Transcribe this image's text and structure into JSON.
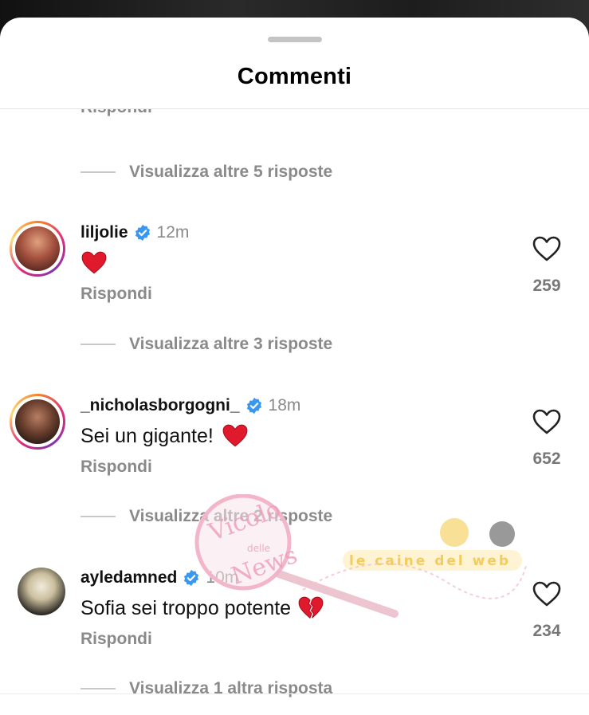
{
  "sheet": {
    "title": "Commenti"
  },
  "previous": {
    "reply_label": "Rispondi",
    "view_replies": "Visualizza altre 5 risposte"
  },
  "comments": [
    {
      "username": "liljolie",
      "verified": true,
      "time": "12m",
      "text": "",
      "emoji": "red-heart-icon",
      "reply_label": "Rispondi",
      "likes": "259",
      "view_replies": "Visualizza altre 3 risposte",
      "avatar_story_ring": true
    },
    {
      "username": "_nicholasborgogni_",
      "verified": true,
      "time": "18m",
      "text": "Sei un gigante!",
      "emoji": "red-heart-icon",
      "reply_label": "Rispondi",
      "likes": "652",
      "view_replies": "Visualizza altre 2 risposte",
      "avatar_story_ring": true
    },
    {
      "username": "ayledamned",
      "verified": true,
      "time": "10m",
      "text": "Sofia sei troppo potente",
      "emoji": "broken-heart-icon",
      "reply_label": "Rispondi",
      "likes": "234",
      "view_replies": "Visualizza 1 altra risposta",
      "avatar_story_ring": false
    }
  ],
  "watermark": {
    "line1": "Vicolo",
    "line2": "delle",
    "line3": "News",
    "banner": "le caine del web"
  },
  "colors": {
    "verified": "#3897f0",
    "heart": "#e0192d",
    "muted": "#8a8a8a"
  }
}
